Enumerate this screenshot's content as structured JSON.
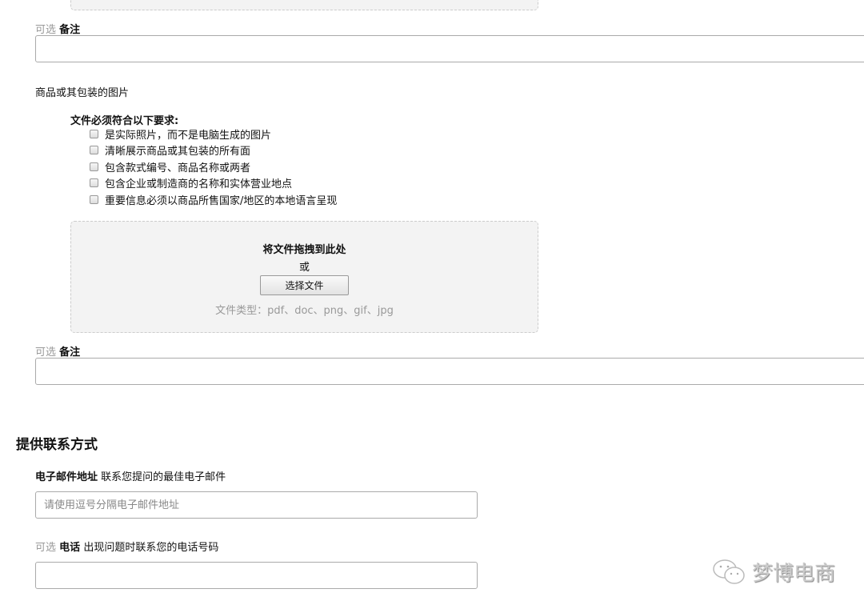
{
  "note1": {
    "optional": "可选",
    "label": "备注",
    "value": ""
  },
  "image_section": {
    "title": "商品或其包装的图片",
    "requirements_title": "文件必须符合以下要求:",
    "requirements": [
      "是实际照片，而不是电脑生成的图片",
      "清晰展示商品或其包装的所有面",
      "包含款式编号、商品名称或两者",
      "包含企业或制造商的名称和实体营业地点",
      "重要信息必须以商品所售国家/地区的本地语言呈现"
    ],
    "dropzone": {
      "title": "将文件拖拽到此处",
      "or": "或",
      "button": "选择文件",
      "file_types": "文件类型：pdf、doc、png、gif、jpg"
    }
  },
  "note2": {
    "optional": "可选",
    "label": "备注",
    "value": ""
  },
  "contact": {
    "title": "提供联系方式",
    "email": {
      "label": "电子邮件地址",
      "hint": "联系您提问的最佳电子邮件",
      "placeholder": "请使用逗号分隔电子邮件地址"
    },
    "phone": {
      "optional": "可选",
      "label": "电话",
      "hint": "出现问题时联系您的电话号码",
      "placeholder": ""
    }
  },
  "watermark": "梦博电商"
}
